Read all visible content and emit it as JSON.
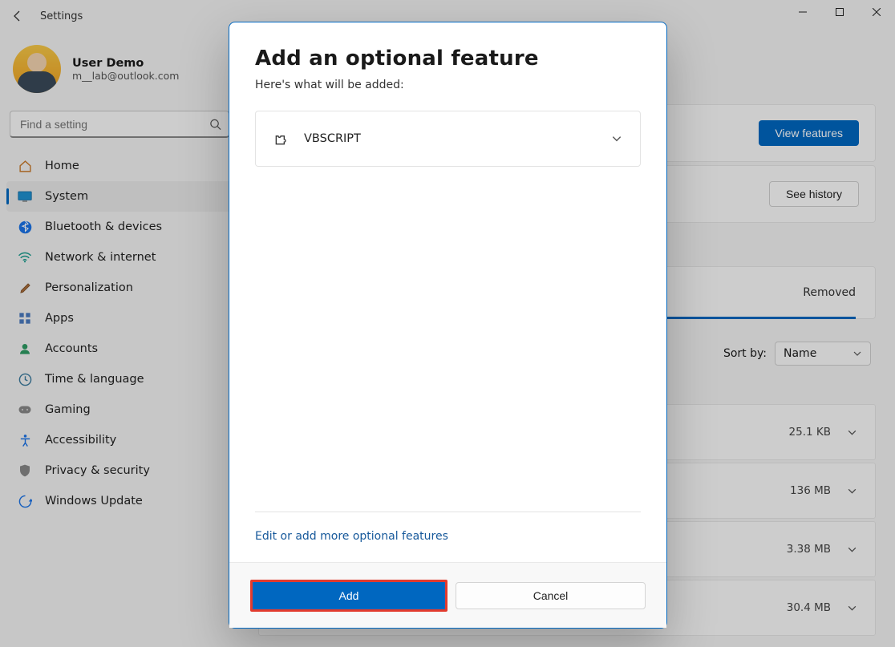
{
  "window": {
    "title": "Settings"
  },
  "user": {
    "name": "User Demo",
    "email": "m__lab@outlook.com"
  },
  "search": {
    "placeholder": "Find a setting"
  },
  "sidebar": {
    "items": [
      {
        "label": "Home",
        "icon": "home-icon"
      },
      {
        "label": "System",
        "icon": "system-icon"
      },
      {
        "label": "Bluetooth & devices",
        "icon": "bluetooth-icon"
      },
      {
        "label": "Network & internet",
        "icon": "wifi-icon"
      },
      {
        "label": "Personalization",
        "icon": "brush-icon"
      },
      {
        "label": "Apps",
        "icon": "apps-icon"
      },
      {
        "label": "Accounts",
        "icon": "person-icon"
      },
      {
        "label": "Time & language",
        "icon": "clock-icon"
      },
      {
        "label": "Gaming",
        "icon": "gamepad-icon"
      },
      {
        "label": "Accessibility",
        "icon": "accessibility-icon"
      },
      {
        "label": "Privacy & security",
        "icon": "shield-icon"
      },
      {
        "label": "Windows Update",
        "icon": "update-icon"
      }
    ],
    "active_index": 1
  },
  "content": {
    "view_features_label": "View features",
    "see_history_label": "See history",
    "status_removed": "Removed",
    "sort_by_label": "Sort by:",
    "sort_value": "Name",
    "feature_rows": [
      {
        "size": "25.1 KB"
      },
      {
        "size": "136 MB"
      },
      {
        "size": "3.38 MB"
      },
      {
        "size": "30.4 MB"
      }
    ]
  },
  "dialog": {
    "title": "Add an optional feature",
    "subtitle": "Here's what will be added:",
    "feature": {
      "name": "VBSCRIPT"
    },
    "edit_link": "Edit or add more optional features",
    "add_label": "Add",
    "cancel_label": "Cancel"
  },
  "accent_color": "#0067c0",
  "highlight_color": "#e23b2e"
}
